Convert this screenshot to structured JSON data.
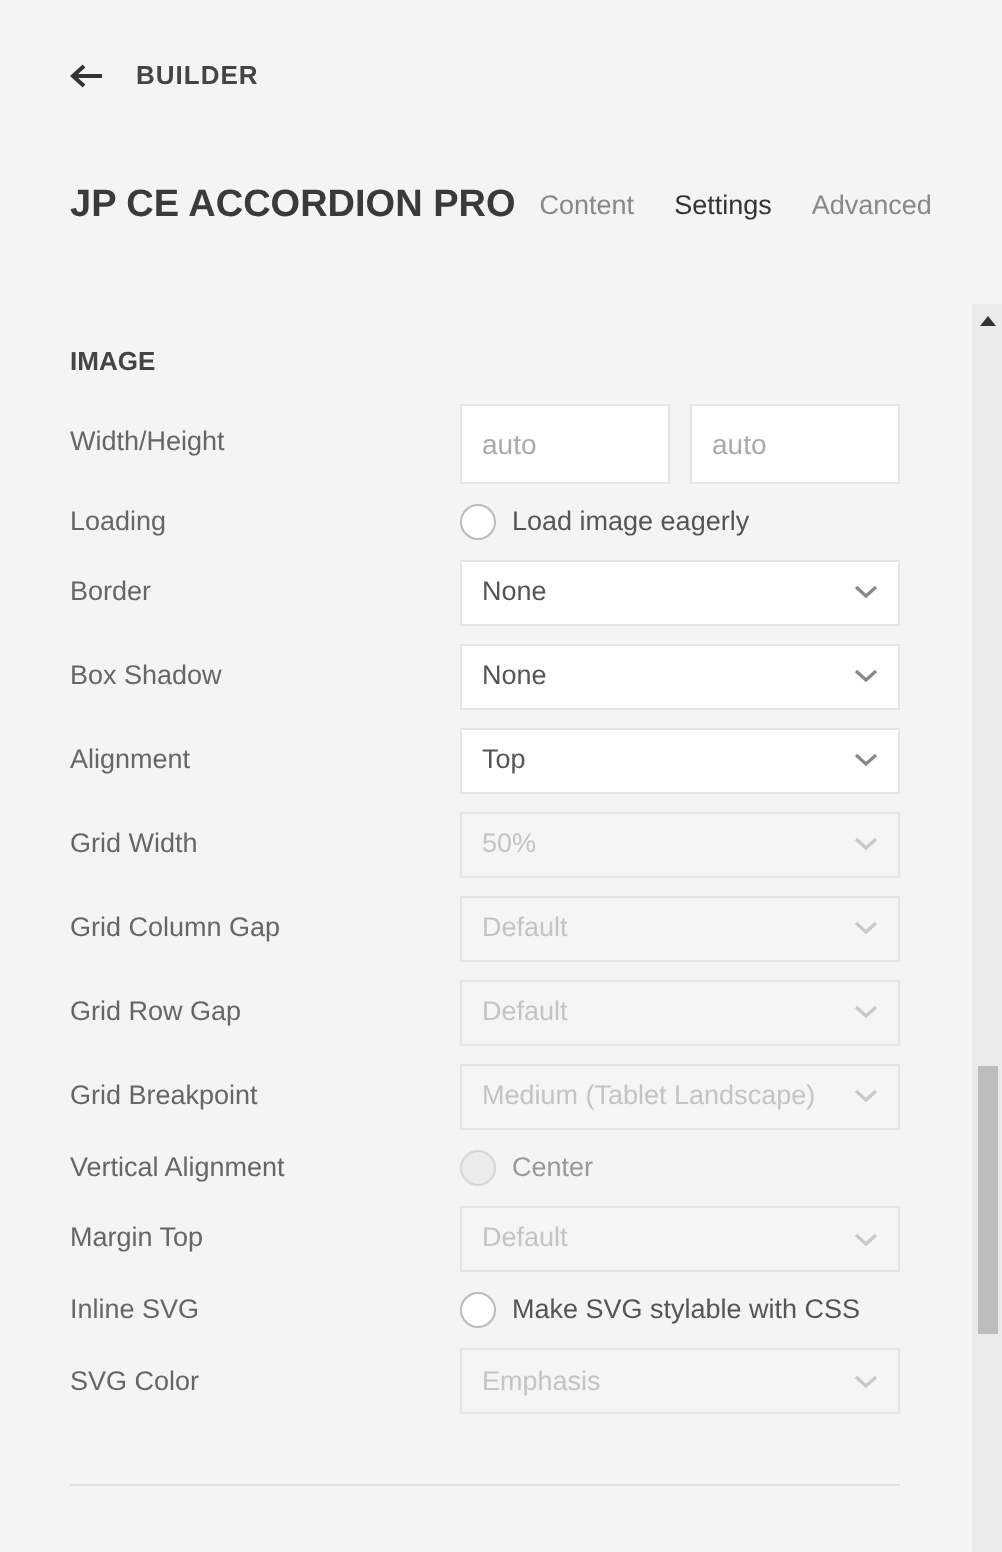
{
  "back": {
    "label": "BUILDER"
  },
  "title": "JP CE ACCORDION PRO",
  "tabs": [
    {
      "label": "Content",
      "selected": false
    },
    {
      "label": "Settings",
      "selected": true
    },
    {
      "label": "Advanced",
      "selected": false
    }
  ],
  "section": "IMAGE",
  "fields": [
    {
      "kind": "size",
      "label": "Width/Height",
      "placeholders": [
        "auto",
        "auto"
      ]
    },
    {
      "kind": "checkbox",
      "label": "Loading",
      "option": "Load image eagerly",
      "checked": false,
      "disabled": false
    },
    {
      "kind": "select",
      "label": "Border",
      "value": "None",
      "disabled": false
    },
    {
      "kind": "select",
      "label": "Box Shadow",
      "value": "None",
      "disabled": false
    },
    {
      "kind": "select",
      "label": "Alignment",
      "value": "Top",
      "disabled": false
    },
    {
      "kind": "select",
      "label": "Grid Width",
      "value": "50%",
      "disabled": true
    },
    {
      "kind": "select",
      "label": "Grid Column Gap",
      "value": "Default",
      "disabled": true
    },
    {
      "kind": "select",
      "label": "Grid Row Gap",
      "value": "Default",
      "disabled": true
    },
    {
      "kind": "select",
      "label": "Grid Breakpoint",
      "value": "Medium (Tablet Landscape)",
      "disabled": true
    },
    {
      "kind": "checkbox",
      "label": "Vertical Alignment",
      "option": "Center",
      "checked": false,
      "disabled": true
    },
    {
      "kind": "select",
      "label": "Margin Top",
      "value": "Default",
      "disabled": true
    },
    {
      "kind": "checkbox",
      "label": "Inline SVG",
      "option": "Make SVG stylable with CSS",
      "checked": false,
      "disabled": false
    },
    {
      "kind": "select",
      "label": "SVG Color",
      "value": "Emphasis",
      "disabled": true
    }
  ]
}
